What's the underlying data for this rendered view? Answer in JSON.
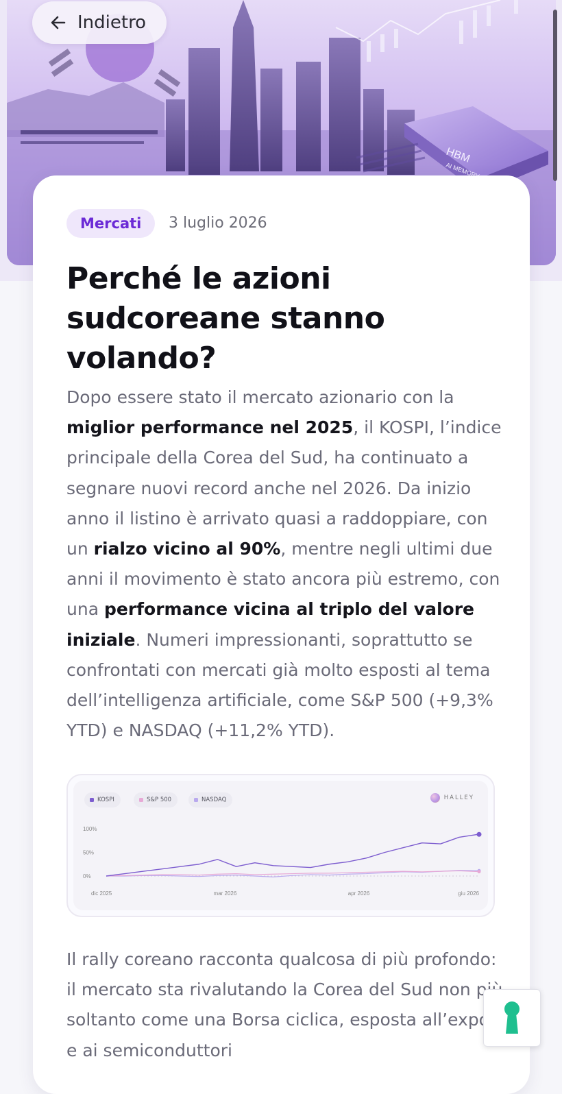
{
  "nav": {
    "back_label": "Indietro"
  },
  "article": {
    "category": "Mercati",
    "date": "3 luglio 2026",
    "title": "Perché le azioni sudcoreane stanno volando?",
    "p1": [
      {
        "t": "Dopo essere stato il mercato azionario con la ",
        "b": false
      },
      {
        "t": "miglior performance nel 2025",
        "b": true
      },
      {
        "t": ", il KOSPI, l’indice principale della Corea del Sud, ha continuato a segnare nuovi record anche nel 2026. Da inizio anno il listino è arrivato quasi a raddoppiare, con un ",
        "b": false
      },
      {
        "t": "rialzo vicino al 90%",
        "b": true
      },
      {
        "t": ", mentre negli ultimi due anni il movimento è stato ancora più estremo, con una ",
        "b": false
      },
      {
        "t": "performance vicina al triplo del valore iniziale",
        "b": true
      },
      {
        "t": ". Numeri impressionanti, soprattutto se confrontati con mercati già molto esposti al tema dell’intelligenza artificiale, come S&P 500 (+9,3% YTD) e NASDAQ (+11,2% YTD).",
        "b": false
      }
    ],
    "p2": "Il rally coreano racconta qualcosa di più profondo: il mercato sta rivalutando la Corea del Sud non più soltanto come una Borsa ciclica, esposta all’export e ai semiconduttori"
  },
  "hero": {
    "chip_line1": "HBM",
    "chip_line2": "AI MEMORY"
  },
  "chart_data": {
    "type": "line",
    "brand": "HALLEY",
    "legend": [
      "KOSPI",
      "S&P 500",
      "NASDAQ"
    ],
    "colors": {
      "KOSPI": "#7c5ccf",
      "S&P 500": "#e7a9d6",
      "NASDAQ": "#b9a9ee"
    },
    "y_ticks": [
      "100%",
      "50%",
      "0%"
    ],
    "x_ticks": [
      "dic 2025",
      "mar 2026",
      "apr 2026",
      "giu 2026"
    ],
    "ylim": [
      0,
      100
    ],
    "x": [
      0,
      5,
      10,
      15,
      20,
      25,
      30,
      35,
      40,
      45,
      50,
      55,
      60,
      65,
      70,
      75,
      80,
      85,
      90,
      95,
      100
    ],
    "series": [
      {
        "name": "KOSPI",
        "values": [
          0,
          5,
          10,
          15,
          20,
          25,
          35,
          20,
          28,
          22,
          20,
          18,
          25,
          30,
          38,
          50,
          60,
          70,
          68,
          82,
          88
        ]
      },
      {
        "name": "S&P 500",
        "values": [
          0,
          1,
          2,
          3,
          3,
          2,
          4,
          5,
          3,
          4,
          5,
          6,
          6,
          7,
          8,
          9,
          10,
          9,
          10,
          11,
          9.3
        ]
      },
      {
        "name": "NASDAQ",
        "values": [
          0,
          0,
          1,
          1,
          0,
          -1,
          1,
          2,
          0,
          -2,
          1,
          3,
          2,
          4,
          5,
          7,
          9,
          8,
          10,
          12,
          11.2
        ]
      }
    ]
  }
}
